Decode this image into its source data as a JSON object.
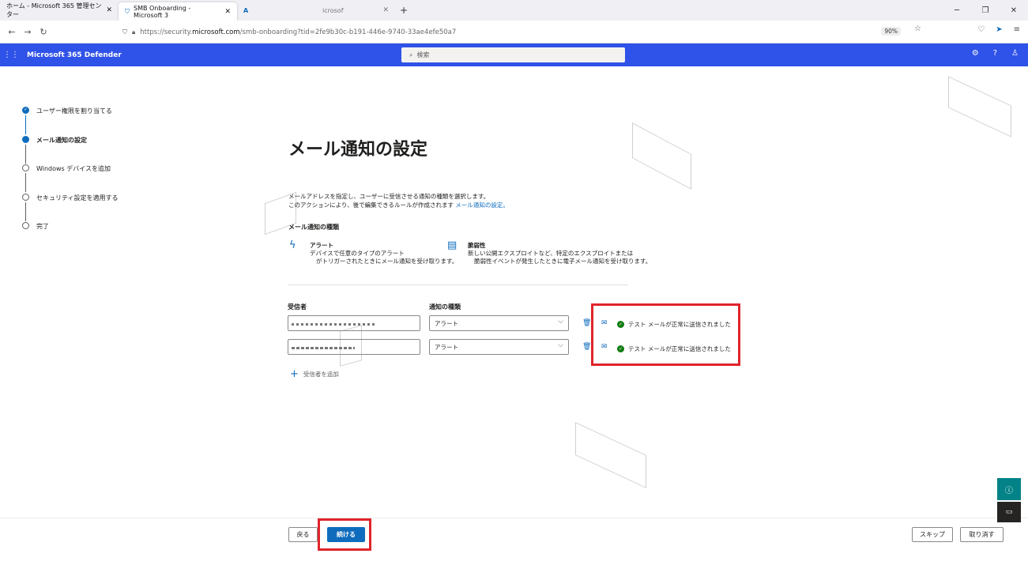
{
  "browser": {
    "tabs": [
      {
        "title": "ホーム - Microsoft 365 管理センター",
        "active": false
      },
      {
        "title": "SMB Onboarding - Microsoft 3",
        "active": true
      },
      {
        "title": "",
        "active": false
      },
      {
        "title": "icrosof",
        "active": false
      }
    ],
    "url_prefix": "https://security.",
    "url_domain": "microsoft.com",
    "url_suffix": "/smb-onboarding?tid=2fe9b30c-b191-446e-9740-33ae4efe50a7",
    "zoom": "90%"
  },
  "suite": {
    "app_name": "Microsoft 365 Defender",
    "search_placeholder": "検索"
  },
  "steps": [
    {
      "label": "ユーザー権限を割り当てる",
      "state": "done"
    },
    {
      "label": "メール通知の設定",
      "state": "current"
    },
    {
      "label": "Windows デバイスを追加",
      "state": "todo"
    },
    {
      "label": "セキュリティ設定を適用する",
      "state": "todo"
    },
    {
      "label": "完了",
      "state": "todo"
    }
  ],
  "main": {
    "title": "メール通知の設定",
    "desc_line1": "メールアドレスを指定し、ユーザーに受信させる通知の種類を選択します。",
    "desc_line2": "このアクションにより、後で編集できるルールが作成されます",
    "desc_link": "メール通知の設定。",
    "types_heading": "メール通知の種類",
    "alert_name": "アラート",
    "alert_desc1": "デバイスで任意のタイプのアラート",
    "alert_desc2": "がトリガーされたときにメール通知を受け取ります。",
    "vuln_name": "脆弱性",
    "vuln_desc1": "新しい公開エクスプロイトなど、特定のエクスプロイトまたは",
    "vuln_desc2": "脆弱性イベントが発生したときに電子メール通知を受け取ります。",
    "col_recipient": "受信者",
    "col_type": "通知の種類",
    "rows": [
      {
        "email": "",
        "type": "アラート",
        "status": "テスト メールが正常に送信されました"
      },
      {
        "email": "",
        "type": "アラート",
        "status": "テスト メールが正常に送信されました"
      }
    ],
    "add_recipient": "受信者を追加"
  },
  "footer": {
    "back": "戻る",
    "continue": "続ける",
    "skip": "スキップ",
    "cancel": "取り消す"
  }
}
